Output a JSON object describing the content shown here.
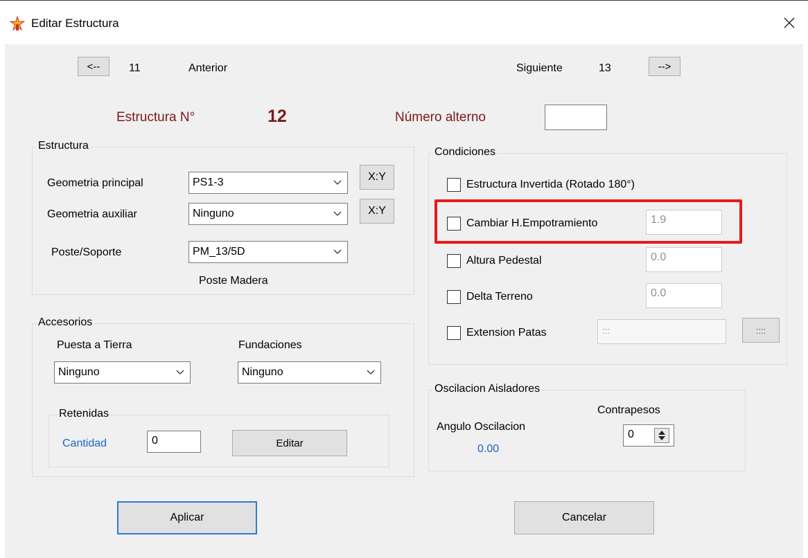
{
  "window": {
    "title": "Editar Estructura"
  },
  "nav": {
    "prev_button": "<--",
    "prev_number": "11",
    "prev_label": "Anterior",
    "next_label": "Siguiente",
    "next_number": "13",
    "next_button": "-->"
  },
  "header": {
    "structure_label": "Estructura N°",
    "structure_number": "12",
    "alt_number_label": "Número alterno",
    "alt_number_value": ""
  },
  "estructura": {
    "legend": "Estructura",
    "geom_principal_label": "Geometria principal",
    "geom_principal_value": "PS1-3",
    "geom_auxiliar_label": "Geometria auxiliar",
    "geom_auxiliar_value": "Ninguno",
    "xy_button": "X:Y",
    "poste_label": "Poste/Soporte",
    "poste_value": "PM_13/5D",
    "poste_desc": "Poste Madera"
  },
  "accesorios": {
    "legend": "Accesorios",
    "puesta_label": "Puesta a Tierra",
    "puesta_value": "Ninguno",
    "fund_label": "Fundaciones",
    "fund_value": "Ninguno",
    "retenidas_legend": "Retenidas",
    "cantidad_label": "Cantidad",
    "cantidad_value": "0",
    "editar_button": "Editar"
  },
  "condiciones": {
    "legend": "Condiciones",
    "invertida_label": "Estructura Invertida (Rotado 180°)",
    "empotramiento_label": "Cambiar H.Empotramiento",
    "empotramiento_value": "1.9",
    "pedestal_label": "Altura Pedestal",
    "pedestal_value": "0.0",
    "delta_label": "Delta Terreno",
    "delta_value": "0.0",
    "patas_label": "Extension Patas",
    "patas_value": ":::",
    "patas_button": "::::"
  },
  "oscilacion": {
    "legend": "Oscilacion Aisladores",
    "angulo_label": "Angulo Oscilacion",
    "angulo_value": "0.00",
    "contrapesos_label": "Contrapesos",
    "contrapesos_value": "0"
  },
  "footer": {
    "aplicar": "Aplicar",
    "cancelar": "Cancelar"
  },
  "colors": {
    "highlight": "#e8191b",
    "dark_red": "#7b1a1a",
    "blue": "#1a64c8"
  }
}
